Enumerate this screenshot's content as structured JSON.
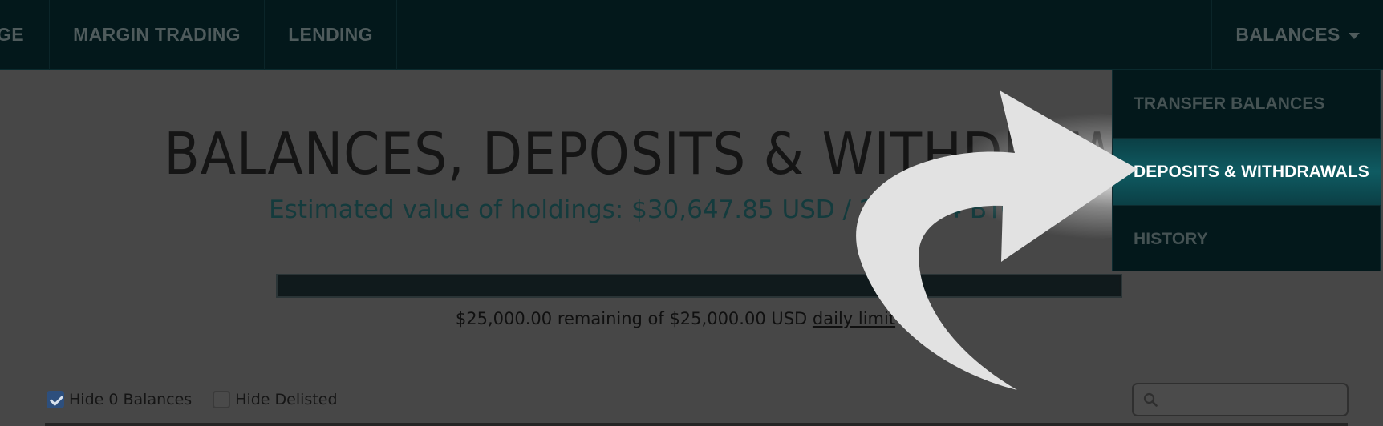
{
  "nav": {
    "exchange_partial": "GE",
    "margin_trading": "MARGIN TRADING",
    "lending": "LENDING",
    "balances": "BALANCES"
  },
  "dropdown": {
    "items": [
      {
        "label": "TRANSFER BALANCES"
      },
      {
        "label": "DEPOSITS & WITHDRAWALS",
        "active": true
      },
      {
        "label": "HISTORY"
      }
    ]
  },
  "main": {
    "title": "BALANCES, DEPOSITS & WITHDRAWALS",
    "estimate": "Estimated value of holdings: $30,647.85 USD / 2.79754 BTC",
    "limit": {
      "remaining_fraction": 1.0,
      "text_prefix": "$25,000.00 remaining of $25,000.00 USD ",
      "link": "daily limit"
    },
    "filters": [
      {
        "label": "Hide 0 Balances",
        "checked": true
      },
      {
        "label": "Hide Delisted",
        "checked": false
      }
    ],
    "search": {
      "placeholder": ""
    }
  },
  "colors": {
    "nav_bg": "#03181b",
    "active_item_bg": "#0f5b62",
    "page_bg": "#474747",
    "accent_text": "#143b3d"
  },
  "icons": [
    "caret-down-icon",
    "search-icon",
    "checkbox-checked-icon",
    "checkbox-empty-icon",
    "curved-arrow-pointer"
  ]
}
